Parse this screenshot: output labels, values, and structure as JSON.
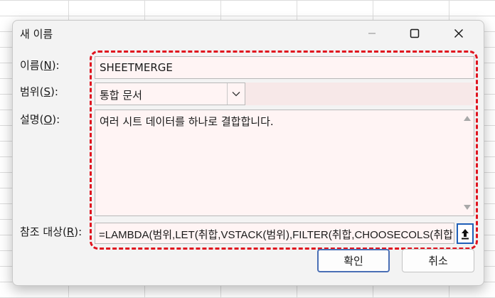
{
  "dialog": {
    "title": "새 이름",
    "window_controls": [
      "minimize-icon",
      "maximize-icon",
      "close-icon"
    ]
  },
  "fields": {
    "name": {
      "label_prefix": "이름(",
      "label_key": "N",
      "label_suffix": "):",
      "value": "SHEETMERGE"
    },
    "scope": {
      "label_prefix": "범위(",
      "label_key": "S",
      "label_suffix": "):",
      "value": "통합 문서"
    },
    "comment": {
      "label_prefix": "설명(",
      "label_key": "O",
      "label_suffix": "):",
      "value": "여러 시트 데이터를 하나로 결합합니다."
    },
    "refers_to": {
      "label_prefix": "참조 대상(",
      "label_key": "R",
      "label_suffix": "):",
      "value": "=LAMBDA(범위,LET(취합,VSTACK(범위),FILTER(취합,CHOOSECOLS(취합"
    }
  },
  "buttons": {
    "ok": "확인",
    "cancel": "취소"
  },
  "colors": {
    "highlight": "#e0131e",
    "field_bg": "#fff4f4",
    "focus_border": "#1f5fb8"
  }
}
